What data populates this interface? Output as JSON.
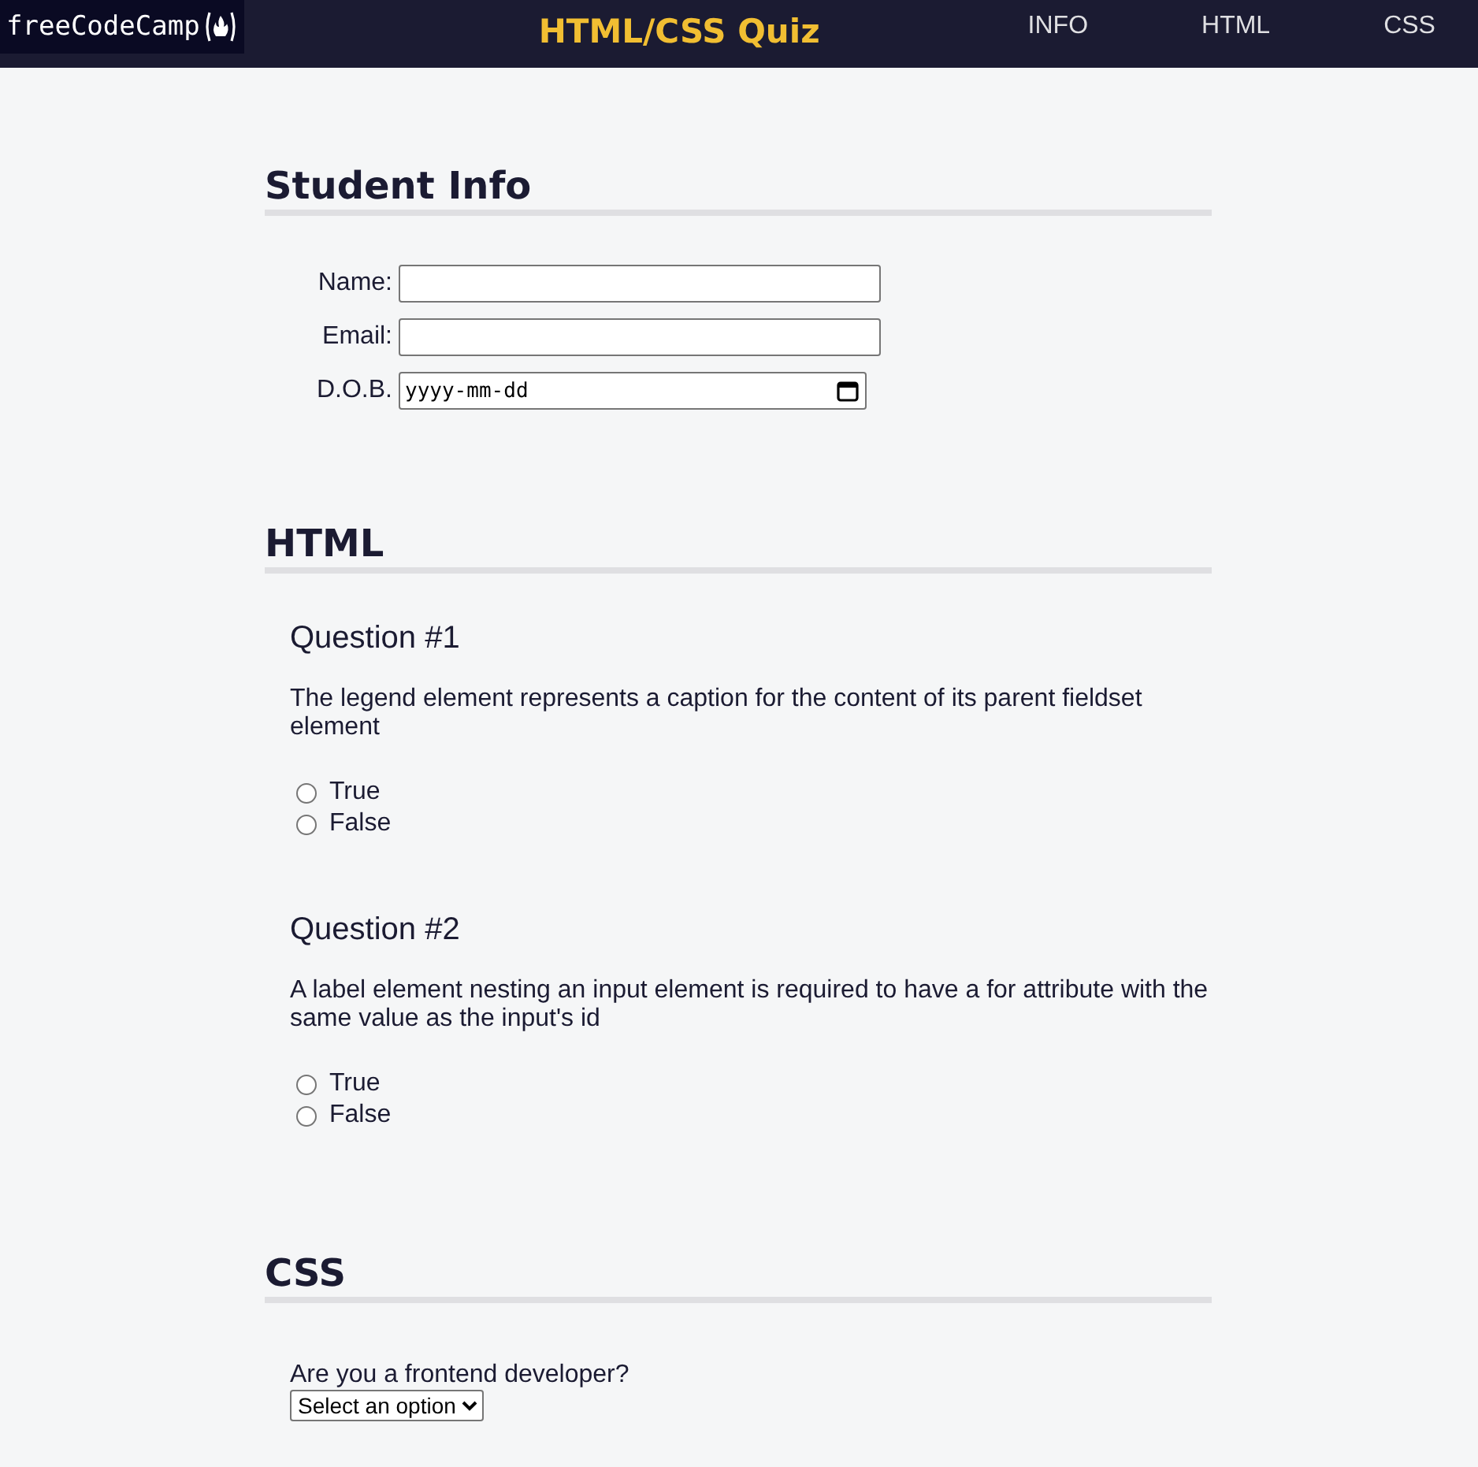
{
  "header": {
    "logo": "freeCodeCamp",
    "title": "HTML/CSS Quiz",
    "nav": [
      "INFO",
      "HTML",
      "CSS"
    ]
  },
  "student_info": {
    "heading": "Student Info",
    "fields": [
      {
        "kind": "text",
        "label": "Name:"
      },
      {
        "kind": "text",
        "label": "Email:"
      },
      {
        "kind": "date",
        "label": "D.O.B.",
        "placeholder": "yyyy-mm-dd"
      }
    ]
  },
  "html": {
    "heading": "HTML",
    "questions": [
      {
        "title": "Question #1",
        "text": "The legend element represents a caption for the content of its parent fieldset element",
        "options": [
          {
            "label": "True",
            "selected": false
          },
          {
            "label": "False",
            "selected": false
          }
        ]
      },
      {
        "title": "Question #2",
        "text": "A label element nesting an input element is required to have a for attribute with the same value as the input's id",
        "options": [
          {
            "label": "True",
            "selected": false
          },
          {
            "label": "False",
            "selected": false
          }
        ]
      }
    ]
  },
  "css": {
    "heading": "CSS",
    "question": "Are you a frontend developer?",
    "select": {
      "value": "Select an option"
    }
  }
}
